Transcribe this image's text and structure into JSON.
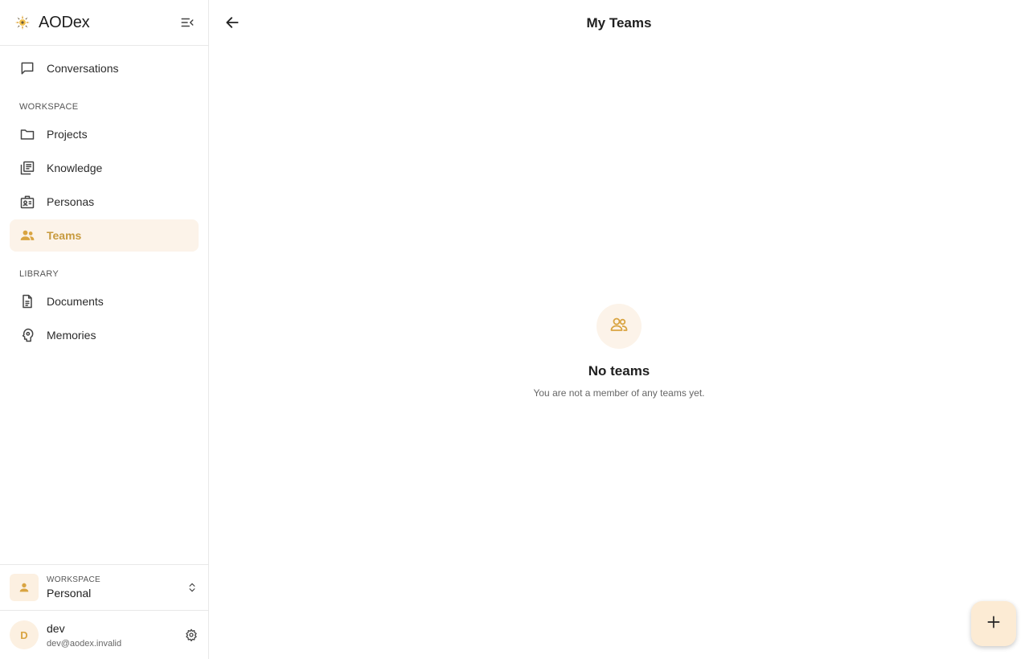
{
  "brand": {
    "name": "AODex",
    "logo_icon": "logo-icon",
    "collapse_icon": "sidebar-collapse-icon"
  },
  "sidebar": {
    "top_items": [
      {
        "label": "Conversations",
        "icon": "chat-bubble-icon"
      }
    ],
    "workspace_section_label": "WORKSPACE",
    "workspace_items": [
      {
        "label": "Projects",
        "icon": "folder-icon"
      },
      {
        "label": "Knowledge",
        "icon": "library-icon"
      },
      {
        "label": "Personas",
        "icon": "id-badge-icon"
      },
      {
        "label": "Teams",
        "icon": "group-icon",
        "active": true
      }
    ],
    "library_section_label": "LIBRARY",
    "library_items": [
      {
        "label": "Documents",
        "icon": "document-icon"
      },
      {
        "label": "Memories",
        "icon": "brain-icon"
      }
    ],
    "workspace_switcher": {
      "label": "WORKSPACE",
      "value": "Personal",
      "icon": "person-icon"
    },
    "user": {
      "initial": "D",
      "name": "dev",
      "email": "dev@aodex.invalid"
    }
  },
  "main": {
    "title": "My Teams",
    "empty_state": {
      "icon": "group-icon",
      "title": "No teams",
      "subtitle": "You are not a member of any teams yet."
    },
    "fab_icon": "plus-icon"
  },
  "colors": {
    "accent": "#d9a441",
    "accent_bg": "#fcf3e9",
    "fab_bg": "#fcebd4"
  }
}
